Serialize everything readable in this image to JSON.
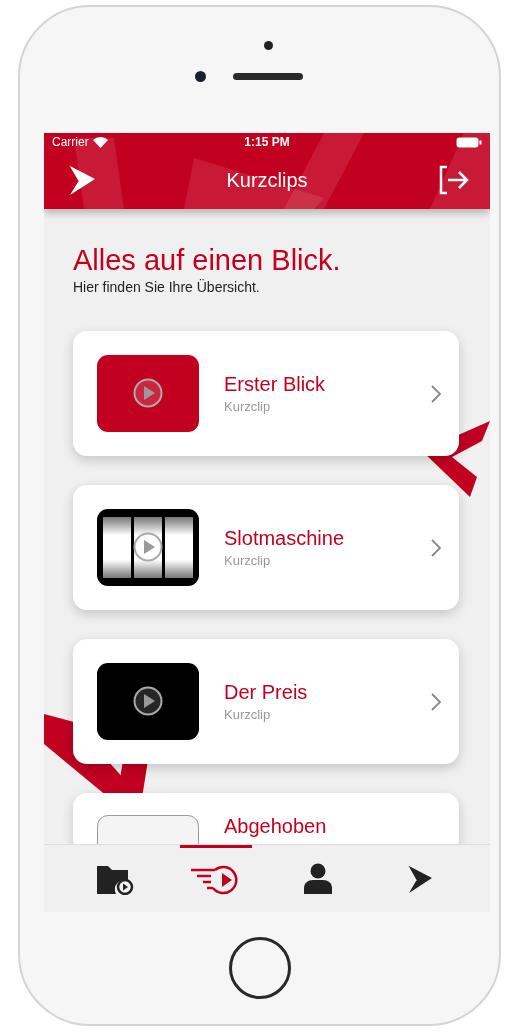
{
  "status_bar": {
    "carrier": "Carrier",
    "time": "1:15 PM"
  },
  "header": {
    "title": "Kurzclips"
  },
  "intro": {
    "heading": "Alles auf einen Blick.",
    "subtitle": "Hier finden Sie Ihre Übersicht."
  },
  "clips": [
    {
      "title": "Erster Blick",
      "subtitle": "Kurzclip",
      "kind": "red"
    },
    {
      "title": "Slotmaschine",
      "subtitle": "Kurzclip",
      "kind": "reels"
    },
    {
      "title": "Der Preis",
      "subtitle": "Kurzclip",
      "kind": "black"
    },
    {
      "title": "Abgehoben",
      "kind": "empty"
    }
  ],
  "tab_bar": [
    {
      "kind": "folder",
      "selected": false
    },
    {
      "kind": "clips",
      "selected": true
    },
    {
      "kind": "person",
      "selected": false
    },
    {
      "kind": "logo",
      "selected": false
    }
  ]
}
